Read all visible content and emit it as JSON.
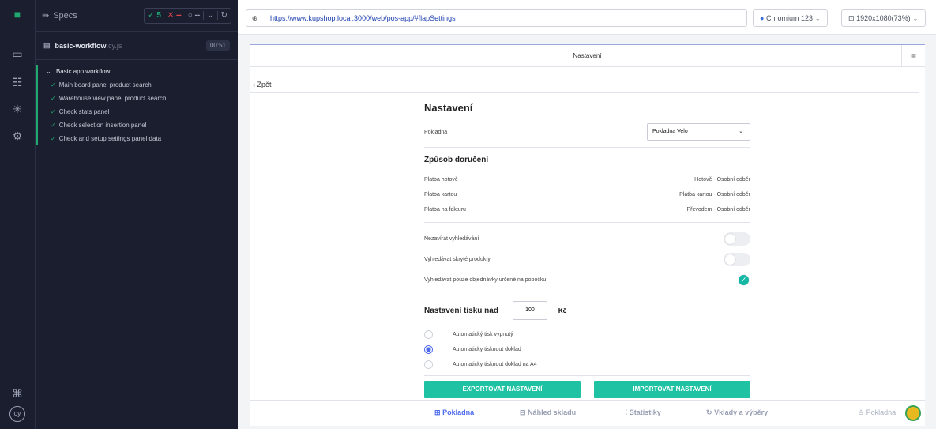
{
  "specs_panel": {
    "title": "Specs",
    "passed": "5",
    "failed": "--",
    "pending": "--",
    "file_name": "basic-workflow",
    "file_ext": ".cy.js",
    "duration": "00:51",
    "suite": "Basic app workflow",
    "tests": [
      "Main board panel product search",
      "Warehouse view panel product search",
      "Check stats panel",
      "Check selection insertion panel",
      "Check and setup settings panel data"
    ]
  },
  "browser_bar": {
    "url": "https://www.kupshop.local:3000/web/pos-app/#flapSettings",
    "browser": "Chromium 123",
    "viewport": "1920x1080",
    "zoom": "(73%)"
  },
  "app": {
    "header_title": "Nastavení",
    "back_label": "‹ Zpět",
    "heading": "Nastavení",
    "register_label": "Pokladna",
    "register_value": "Pokladna Velo",
    "delivery_heading": "Způsob doručení",
    "delivery_rows": [
      {
        "label": "Platba hotově",
        "value": "Hotově - Osobní odběr"
      },
      {
        "label": "Platba kartou",
        "value": "Platba kartou - Osobní odběr"
      },
      {
        "label": "Platba na fakturu",
        "value": "Převodem - Osobní odběr"
      }
    ],
    "toggles": [
      {
        "label": "Nezavírat vyhledávání",
        "on": false
      },
      {
        "label": "Vyhledávat skryté produkty",
        "on": false
      },
      {
        "label": "Vyhledávat pouze objednávky určené na pobočku",
        "on": true
      }
    ],
    "print_heading": "Nastavení tisku nad",
    "print_value": "100",
    "print_currency": "Kč",
    "print_options": [
      {
        "label": "Automatický tisk vypnutý",
        "selected": false
      },
      {
        "label": "Automaticky tisknout doklad",
        "selected": true
      },
      {
        "label": "Automaticky tisknout doklad na A4",
        "selected": false
      }
    ],
    "export_label": "EXPORTOVAT NASTAVENÍ",
    "import_label": "IMPORTOVAT NASTAVENÍ",
    "tabs": [
      "Pokladna",
      "Náhled skladu",
      "Statistiky",
      "Vklady a výběry"
    ],
    "user_label": "Pokladna",
    "accent": "#4f6bed",
    "button_color": "#20c2a4"
  }
}
